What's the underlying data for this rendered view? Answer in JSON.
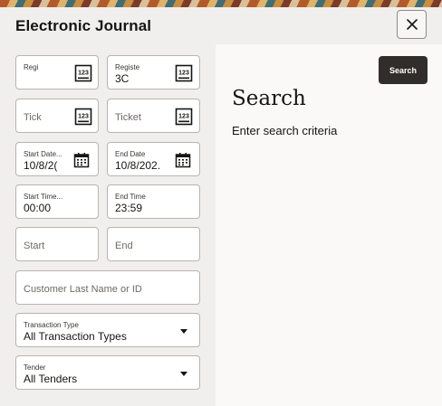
{
  "window": {
    "title": "Electronic Journal",
    "close_icon": "close-icon"
  },
  "fields": {
    "register_1": {
      "label": "Regi",
      "value": "",
      "icon": "number-pad-icon"
    },
    "register_2": {
      "label": "Registe",
      "value": "3C",
      "icon": "number-pad-icon"
    },
    "ticket_1": {
      "placeholder": "Tick",
      "icon": "number-pad-icon"
    },
    "ticket_2": {
      "placeholder": "Ticket",
      "icon": "number-pad-icon"
    },
    "start_date": {
      "label": "Start Date...",
      "value": "10/8/2(",
      "icon": "calendar-icon"
    },
    "end_date": {
      "label": "End Date",
      "value": "10/8/202.",
      "icon": "calendar-icon"
    },
    "start_time": {
      "label": "Start Time...",
      "value": "00:00"
    },
    "end_time": {
      "label": "End Time",
      "value": "23:59"
    },
    "start": {
      "placeholder": "Start"
    },
    "end": {
      "placeholder": "End"
    },
    "customer": {
      "placeholder": "Customer Last Name or ID"
    },
    "transaction_type": {
      "label": "Transaction Type",
      "value": "All Transaction Types"
    },
    "tender": {
      "label": "Tender",
      "value": "All Tenders"
    }
  },
  "search": {
    "button_label": "Search",
    "heading": "Search",
    "subtext": "Enter search criteria"
  },
  "colors": {
    "primary_button": "#312d2a",
    "panel_bg": "#f1efed",
    "content_bg": "#fbf9f8"
  }
}
